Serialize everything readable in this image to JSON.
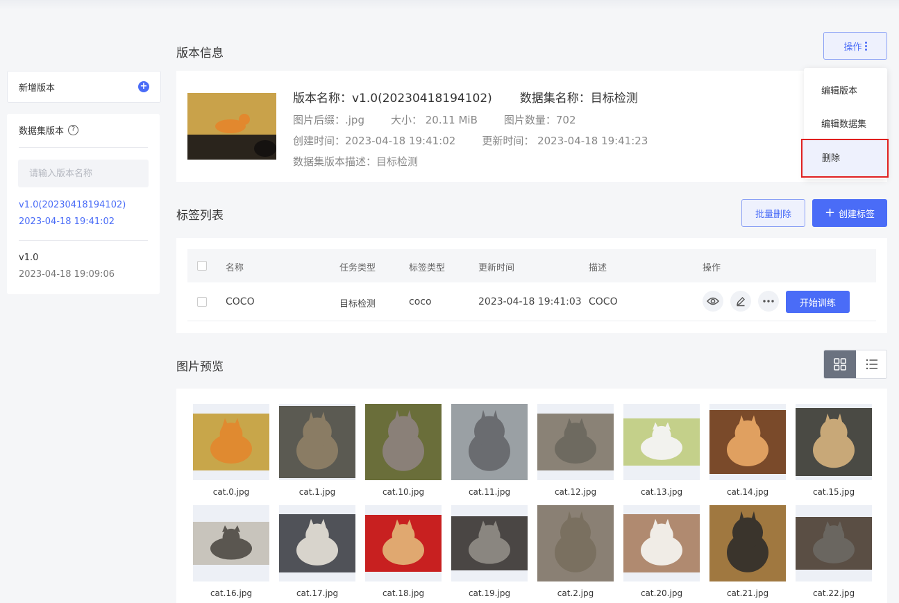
{
  "sidebar": {
    "add_version_label": "新增版本",
    "versions_title": "数据集版本",
    "search_placeholder": "请输入版本名称",
    "versions": [
      {
        "name": "v1.0(20230418194102)",
        "date": "2023-04-18 19:41:02",
        "active": true
      },
      {
        "name": "v1.0",
        "date": "2023-04-18 19:09:06",
        "active": false
      }
    ]
  },
  "version_info": {
    "section_title": "版本信息",
    "ops_label": "操作",
    "ops_menu": [
      "编辑版本",
      "编辑数据集",
      "删除"
    ],
    "name_line": "版本名称：v1.0(20230418194102)",
    "dataset_line": "数据集名称：目标检测",
    "suffix": "图片后缀：.jpg",
    "size": "大小：  20.11 MiB",
    "count": "图片数量：702",
    "created": "创建时间：2023-04-18 19:41:02",
    "updated": "更新时间：  2023-04-18 19:41:23",
    "description": "数据集版本描述：目标检测"
  },
  "labels": {
    "section_title": "标签列表",
    "batch_delete": "批量删除",
    "create_label": "创建标签",
    "columns": [
      "名称",
      "任务类型",
      "标签类型",
      "更新时间",
      "描述",
      "操作"
    ],
    "rows": [
      {
        "name": "COCO",
        "task": "目标检测",
        "label_type": "coco",
        "updated": "2023-04-18 19:41:03",
        "desc": "COCO",
        "train": "开始训练"
      }
    ]
  },
  "preview": {
    "section_title": "图片预览",
    "images": [
      {
        "name": "cat.0.jpg",
        "bg": "#c8a64a",
        "fg": "#e08a30"
      },
      {
        "name": "cat.1.jpg",
        "bg": "#5b5a52",
        "fg": "#8a7c64"
      },
      {
        "name": "cat.10.jpg",
        "bg": "#6a6e3a",
        "fg": "#8a8078"
      },
      {
        "name": "cat.11.jpg",
        "bg": "#9aa0a4",
        "fg": "#6a6c70"
      },
      {
        "name": "cat.12.jpg",
        "bg": "#8a8276",
        "fg": "#6e6a60"
      },
      {
        "name": "cat.13.jpg",
        "bg": "#c4d08a",
        "fg": "#f2f2ee"
      },
      {
        "name": "cat.14.jpg",
        "bg": "#7a4a2a",
        "fg": "#e0a060"
      },
      {
        "name": "cat.15.jpg",
        "bg": "#4a4a44",
        "fg": "#c8a878"
      },
      {
        "name": "cat.16.jpg",
        "bg": "#c8c4bc",
        "fg": "#5a5650"
      },
      {
        "name": "cat.17.jpg",
        "bg": "#505258",
        "fg": "#d8d4cc"
      },
      {
        "name": "cat.18.jpg",
        "bg": "#c82020",
        "fg": "#e0a870"
      },
      {
        "name": "cat.19.jpg",
        "bg": "#4a4644",
        "fg": "#8a8680"
      },
      {
        "name": "cat.2.jpg",
        "bg": "#8a8074",
        "fg": "#7a7060"
      },
      {
        "name": "cat.20.jpg",
        "bg": "#b08a70",
        "fg": "#f0ece6"
      },
      {
        "name": "cat.21.jpg",
        "bg": "#a07840",
        "fg": "#3a342c"
      },
      {
        "name": "cat.22.jpg",
        "bg": "#5a4e44",
        "fg": "#6a6660"
      }
    ]
  }
}
